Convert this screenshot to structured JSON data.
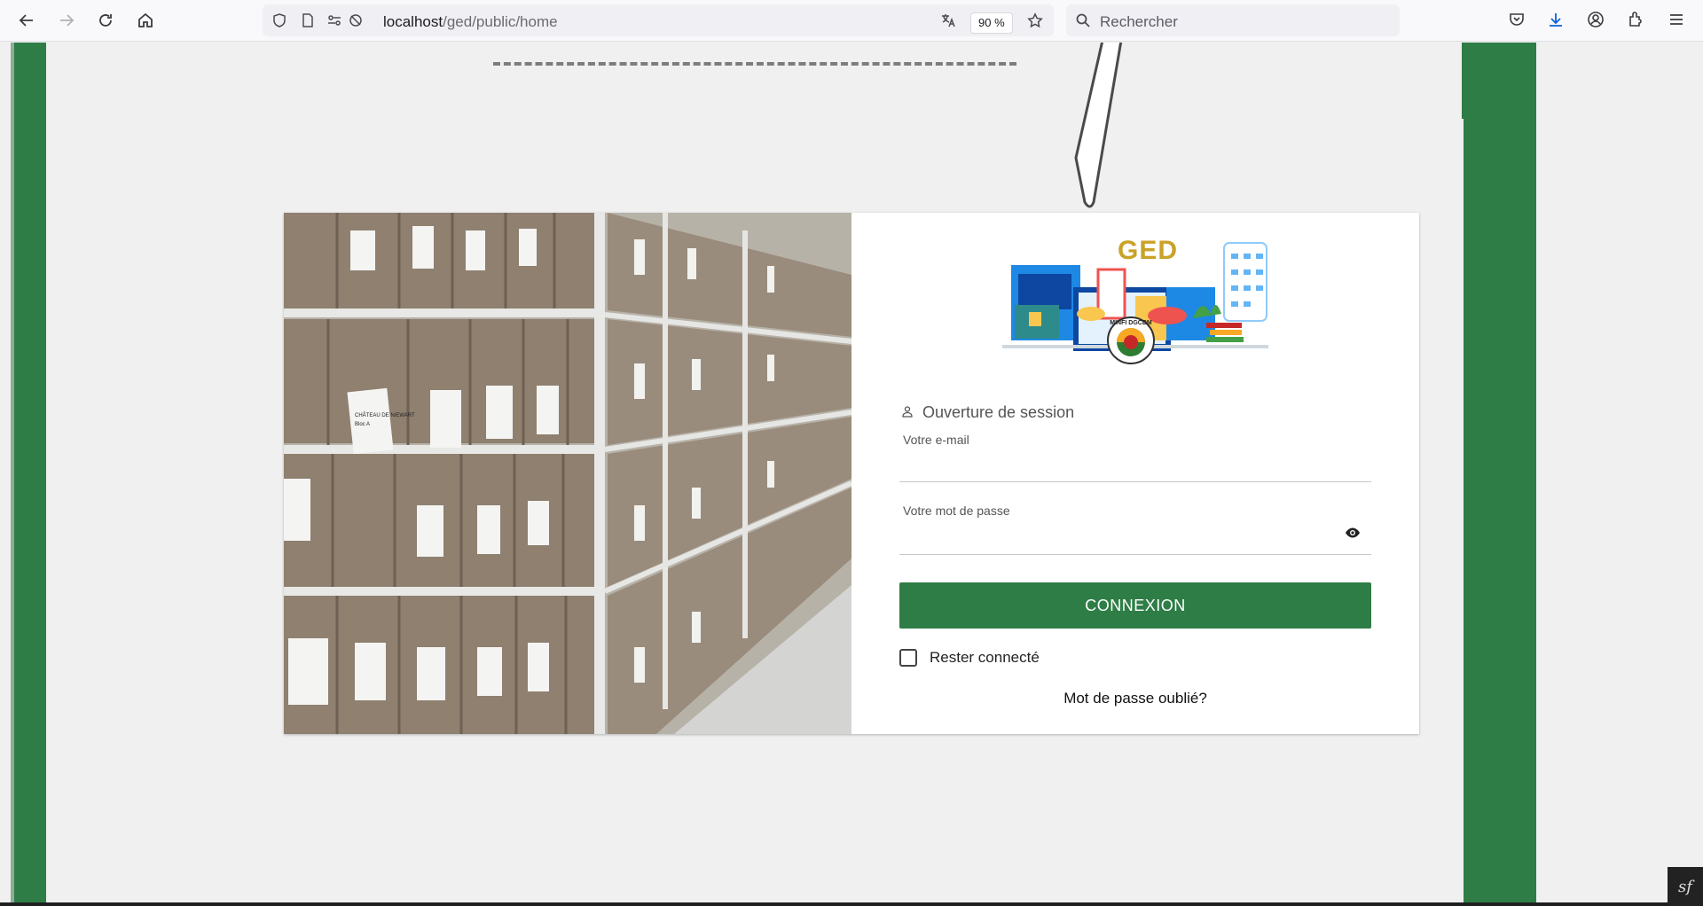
{
  "browser": {
    "url_host": "localhost",
    "url_path": "/ged/public/home",
    "zoom": "90 %",
    "search_placeholder": "Rechercher"
  },
  "logo": {
    "title": "GED",
    "seal_text": "MINFI DGCDM"
  },
  "login": {
    "heading": "Ouverture de session",
    "email_label": "Votre e-mail",
    "email_value": "",
    "password_label": "Votre mot de passe",
    "password_value": "",
    "submit_label": "CONNEXION",
    "remember_label": "Rester connecté",
    "remember_checked": false,
    "forgot_label": "Mot de passe oublié?"
  },
  "photo_labels": [
    "CHÂTEAU DE NIEWART",
    "Bloc A"
  ],
  "footer": {
    "symfony_badge": "sf"
  },
  "colors": {
    "primary_green": "#2e7d46",
    "logo_gold": "#c9a227"
  }
}
